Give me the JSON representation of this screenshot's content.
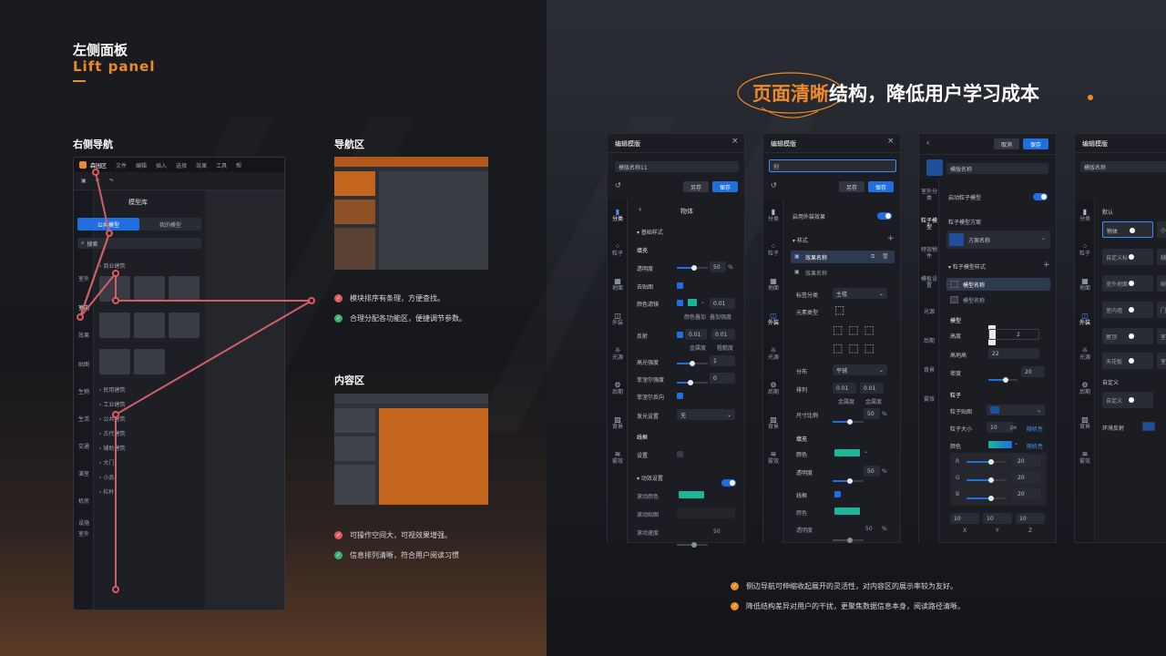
{
  "header": {
    "title_cn": "左侧面板",
    "title_en": "Lift  panel",
    "right_title_highlight": "页面清晰",
    "right_title_rest": "结构，降低用户学习成本"
  },
  "sections": {
    "right_nav": "右侧导航",
    "nav_area": "导航区",
    "content_area": "内容区"
  },
  "bullets_nav": [
    "模块排序有条理，方便查找。",
    "合理分配各功能区，便捷调节参数。"
  ],
  "bullets_content": [
    "可操作空间大，可视效果增强。",
    "信息排列清晰，符合用户阅读习惯"
  ],
  "bullets_right": [
    "侧边导航可伸缩收起展开的灵活性，对内容区的展示率较为友好。",
    "降低结构差异对用户的干扰，更聚焦数据信息本身，阅读路径清晰。"
  ],
  "app_mock": {
    "app_name": "森园区",
    "menu": [
      "文件",
      "编辑",
      "插入",
      "选择",
      "效果",
      "工具",
      "帮"
    ],
    "library_title": "模型库",
    "tabs": [
      "公共模型",
      "我的模型"
    ],
    "search_placeholder": "搜索",
    "nav": [
      "室外",
      "室内",
      "效果",
      "贴图",
      "生物",
      "生活",
      "交通",
      "演室",
      "机房",
      "设施",
      "室外"
    ],
    "tree": [
      "商业建筑",
      "民用建筑",
      "工业建筑",
      "公共建筑",
      "古代建筑",
      "辅助建筑",
      "大门",
      "小品",
      "栏杆"
    ]
  },
  "panel1": {
    "title": "编辑模版",
    "name_value": "模版名称11",
    "btn_save_as": "另存",
    "btn_save": "保存",
    "sub_title": "物体",
    "nav": [
      "分类",
      "粒子",
      "地面",
      "外装",
      "光源",
      "后期",
      "背景",
      "雾效"
    ],
    "group1": "基础样式",
    "fill": "填充",
    "opacity": "透明度",
    "opacity_val": "50",
    "pct": "%",
    "map": "去贴图",
    "color_filter": "颜色滤镜",
    "color_filter_val": "0.01",
    "color_overlay": "颜色叠加",
    "overlay_strength": "叠加强度",
    "reflect": "反射",
    "reflect_v1": "0.01",
    "reflect_v2": "0.01",
    "metal": "金属度",
    "rough": "粗糙度",
    "highlight": "高光强度",
    "highlight_val": "1",
    "fresnel": "菲涅尔强度",
    "fresnel_val": "0",
    "fresnel_rev": "菲涅尔反向",
    "glow": "发光设置",
    "glow_val": "无",
    "wire": "线框",
    "wire_set": "设置",
    "anim_group": "动效设置",
    "scroll_color": "滚动颜色",
    "scroll_map": "滚动贴图",
    "scroll_speed": "滚动速度",
    "scroll_speed_val": "50"
  },
  "panel2": {
    "title": "编辑模版",
    "name_value": "创",
    "btn_save_as": "另存",
    "btn_save": "保存",
    "nav": [
      "分类",
      "粒子",
      "地面",
      "外装",
      "光源",
      "后期",
      "背景",
      "雾效"
    ],
    "enable": "启用外装效果",
    "style": "样式",
    "effect_name_1": "效果名称",
    "effect_name_2": "效果名称",
    "tag_class": "标签分类",
    "tag_class_val": "主楼",
    "element_type": "元素类型",
    "distribution": "分布",
    "distribution_val": "平铺",
    "arrange": "排列",
    "arrange_v1": "0.01",
    "arrange_v2": "0.01",
    "metal": "金属度",
    "metal2": "金属度",
    "scale": "尺寸比例",
    "scale_val": "50",
    "pct": "%",
    "fill": "填充",
    "color": "颜色",
    "opacity": "透明度",
    "opacity_val": "50",
    "wire": "线框",
    "wire_color": "颜色",
    "wire_opacity": "透明度",
    "wire_opacity_val": "50"
  },
  "panel3": {
    "btn_cancel": "取消",
    "btn_save": "保存",
    "name_value": "模版名称",
    "nav": [
      "室外分类",
      "粒子模型",
      "特效物件",
      "模板设置",
      "光源",
      "后期",
      "背景",
      "雾效"
    ],
    "enable": "启动粒子模型",
    "scheme": "粒子模型方案",
    "scheme_val": "方案名称",
    "style": "粒子模型样式",
    "model_name_1": "模型名称",
    "model_name_2": "模型名称",
    "model": "模型",
    "height": "高度",
    "height_val": "2",
    "max_height": "高地高",
    "max_height_val": "22",
    "density": "密度",
    "density_val": "20",
    "particle": "粒子",
    "particle_map": "粒子贴图",
    "particle_size": "粒子大小",
    "particle_size_val": "10",
    "px": "px",
    "random": "随机性",
    "color": "颜色",
    "random2": "随机性",
    "r": "R",
    "g": "G",
    "b": "B",
    "r_val": "20",
    "g_val": "20",
    "b_val": "20",
    "x_val": "10",
    "y_val": "10",
    "z_val": "10",
    "x": "X",
    "y": "Y",
    "z": "Z"
  },
  "panel4": {
    "title": "编辑模版",
    "name_value": "模版名称",
    "nav": [
      "分类",
      "粒子",
      "地面",
      "外装",
      "光源",
      "后期",
      "背景",
      "雾效"
    ],
    "default": "默认",
    "rows": [
      "物体",
      "自定义标",
      "室外地面",
      "室内墙",
      "屋顶",
      "天花板"
    ],
    "rows_right": [
      "小",
      "辅",
      "树",
      "门",
      "室",
      "室"
    ],
    "custom": "自定义",
    "custom_item": "自定义",
    "env_reflect": "环境反射"
  }
}
